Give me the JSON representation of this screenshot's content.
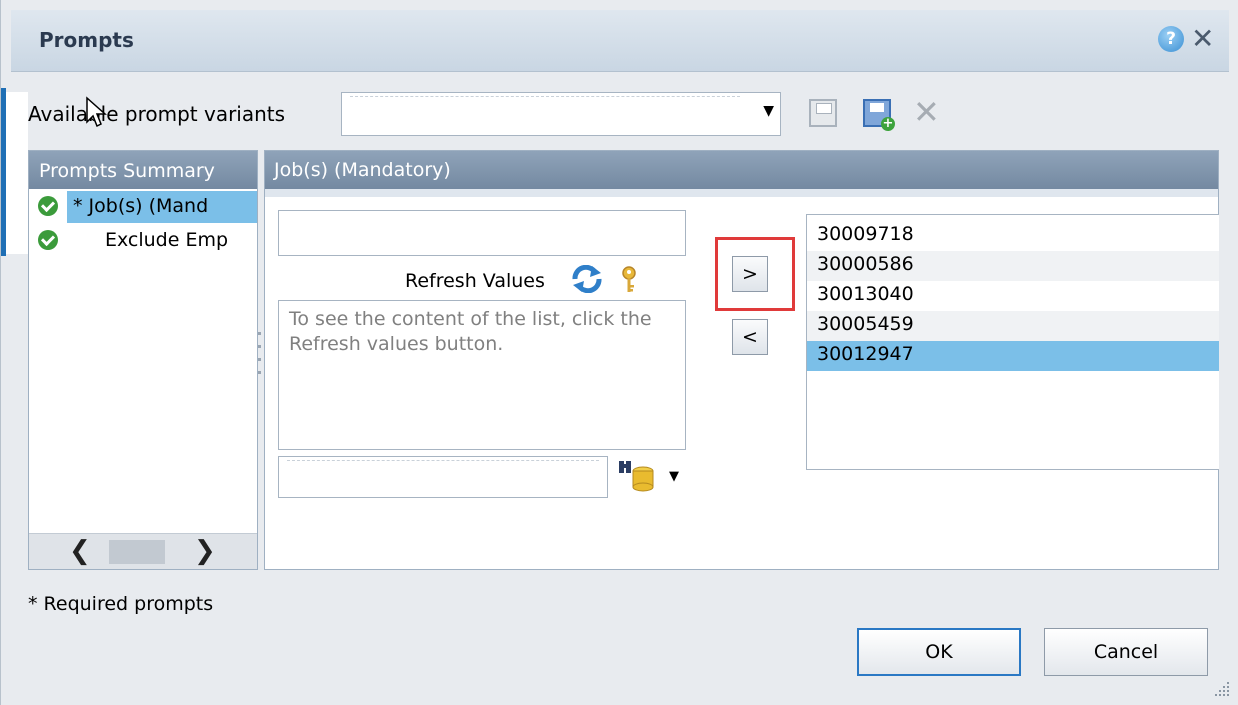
{
  "dialog": {
    "title": "Prompts",
    "help_icon": "help-icon",
    "close_icon": "close-icon"
  },
  "variants": {
    "label": "Available prompt variants",
    "value": "",
    "icons": [
      "save-icon",
      "save-as-icon",
      "delete-icon"
    ]
  },
  "summary": {
    "header": "Prompts Summary",
    "items": [
      {
        "label": "* Job(s) (Mand",
        "status": "check-icon",
        "selected": true
      },
      {
        "label": "Exclude Emp",
        "status": "check-icon",
        "selected": false
      }
    ]
  },
  "panel": {
    "header": "Job(s) (Mandatory)",
    "search_value": "",
    "refresh_label": "Refresh Values",
    "list_hint": "To see the content of the list, click the Refresh values button.",
    "add_label": ">",
    "remove_label": "<",
    "selected_values": [
      "30009718",
      "30000586",
      "30013040",
      "30005459",
      "30012947"
    ],
    "selected_highlight": "30012947"
  },
  "footer": {
    "required_note": "* Required prompts",
    "ok_label": "OK",
    "cancel_label": "Cancel"
  },
  "colors": {
    "header_blue": "#8093ab",
    "selection": "#7bbfe8",
    "ok_border": "#2a78c4",
    "highlight_box": "#e03a3a"
  }
}
